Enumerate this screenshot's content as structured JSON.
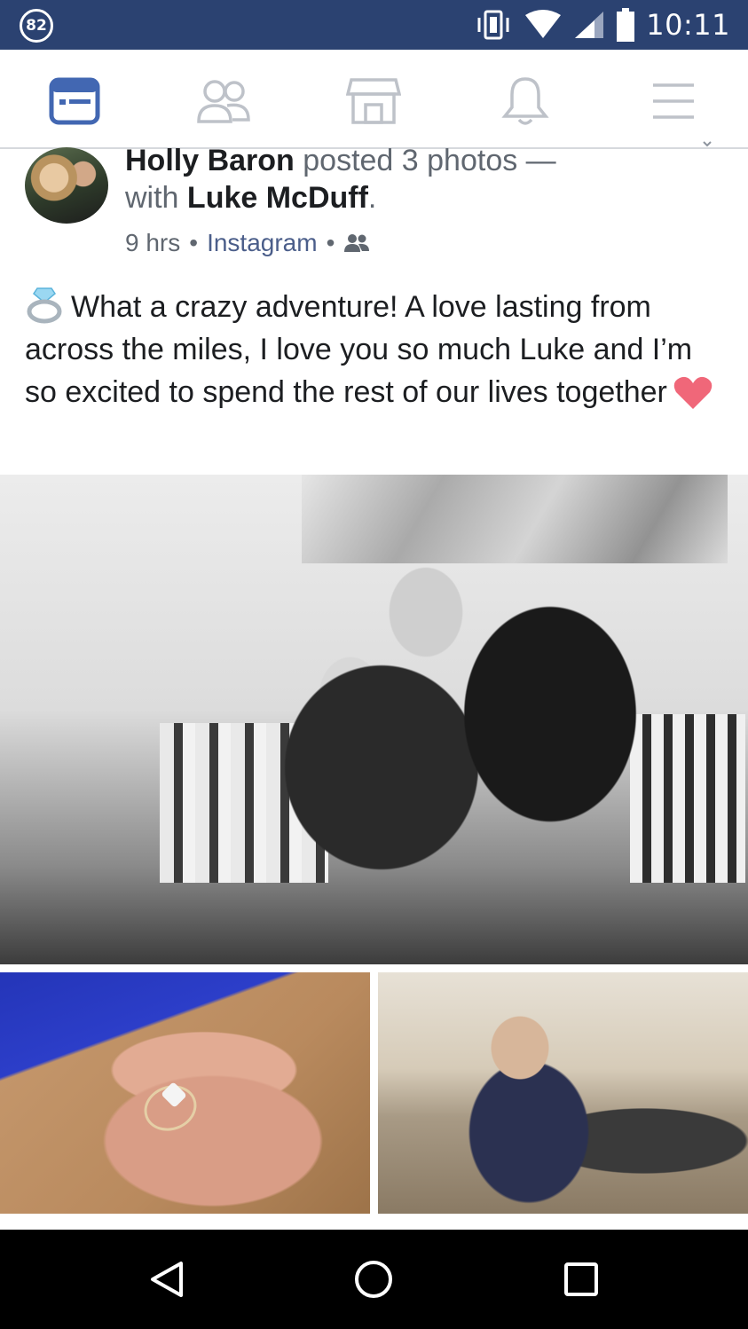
{
  "status_bar": {
    "notification_count": "82",
    "time": "10:11",
    "icons": [
      "vibrate-icon",
      "wifi-icon",
      "signal-icon",
      "battery-icon"
    ]
  },
  "nav": {
    "active_color": "#4267b2",
    "inactive_color": "#bec2c9",
    "items": [
      {
        "icon": "news-feed-icon",
        "active": true
      },
      {
        "icon": "friends-icon",
        "active": false
      },
      {
        "icon": "marketplace-icon",
        "active": false
      },
      {
        "icon": "notifications-icon",
        "active": false
      },
      {
        "icon": "menu-icon",
        "active": false
      }
    ]
  },
  "post": {
    "author": "Holly Baron",
    "action": " posted 3 photos —",
    "with_prefix": "with ",
    "tagged": "Luke McDuff",
    "period": ".",
    "time": "9 hrs",
    "separator": "•",
    "source": "Instagram",
    "audience_icon": "friends-audience-icon",
    "text": "What a crazy adventure! A love lasting from across the miles, I love you so much Luke and I’m so excited to spend the rest of our lives together",
    "leading_emoji": "ring-icon",
    "trailing_emoji": "heart-icon",
    "photos": [
      "couple-on-sofa-photo",
      "engagement-ring-photo",
      "couple-on-couch-photo"
    ]
  }
}
